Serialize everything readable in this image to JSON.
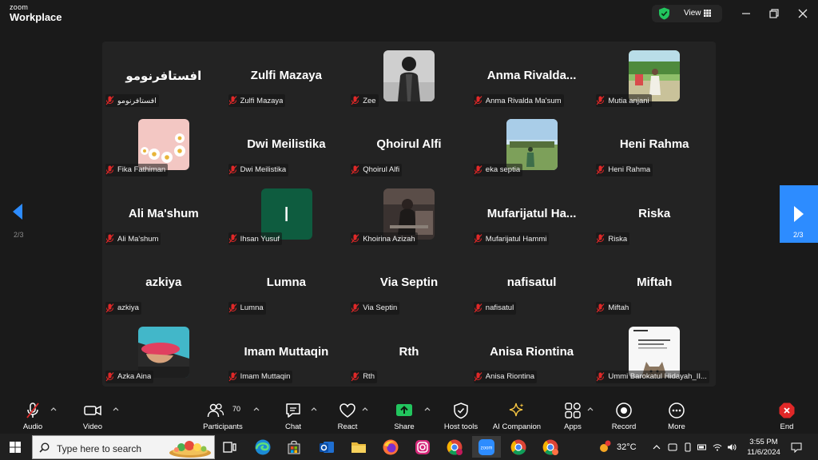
{
  "window": {
    "brand_line1": "zoom",
    "brand_line2": "Workplace",
    "view_label": "View",
    "security_color": "#22c55e",
    "controls": [
      "minimize-icon",
      "restore-icon",
      "close-icon"
    ]
  },
  "gallery": {
    "page_indicator": "2/3",
    "tiles": [
      {
        "big": "افستافرنومو",
        "plate": "افستافرنومو",
        "avatar": null
      },
      {
        "big": "Zulfi Mazaya",
        "plate": "Zulfi Mazaya",
        "avatar": null
      },
      {
        "big": "",
        "plate": "Zee",
        "avatar": "photo-person-dark"
      },
      {
        "big": "Anma  Rivalda...",
        "plate": "Anma Rivalda Ma'sum",
        "avatar": null
      },
      {
        "big": "",
        "plate": "Mutia anjani",
        "avatar": "photo-outdoor-green"
      },
      {
        "big": "",
        "plate": "Fika Fathiman",
        "avatar": "photo-daisies-pink"
      },
      {
        "big": "Dwi Meilistika",
        "plate": "Dwi Meilistika",
        "avatar": null
      },
      {
        "big": "Qhoirul Alfi",
        "plate": "Qhoirul Alfi",
        "avatar": null
      },
      {
        "big": "",
        "plate": "eka septia",
        "avatar": "photo-field-sky"
      },
      {
        "big": "Heni Rahma",
        "plate": "Heni Rahma",
        "avatar": null
      },
      {
        "big": "Ali Ma'shum",
        "plate": "Ali Ma'shum",
        "avatar": null
      },
      {
        "big": "",
        "plate": "Ihsan Yusuf",
        "avatar": "letter",
        "letter": "I"
      },
      {
        "big": "",
        "plate": "Khoirina Azizah",
        "avatar": "photo-person-piano"
      },
      {
        "big": "Mufarijatul  Ha...",
        "plate": "Mufarijatul Hammi",
        "avatar": null
      },
      {
        "big": "Riska",
        "plate": "Riska",
        "avatar": null
      },
      {
        "big": "azkiya",
        "plate": "azkiya",
        "avatar": null
      },
      {
        "big": "Lumna",
        "plate": "Lumna",
        "avatar": null
      },
      {
        "big": "Via Septin",
        "plate": "Via Septin",
        "avatar": null
      },
      {
        "big": "nafisatul",
        "plate": "nafisatul",
        "avatar": null
      },
      {
        "big": "Miftah",
        "plate": "Miftah",
        "avatar": null
      },
      {
        "big": "",
        "plate": "Azka Aina",
        "avatar": "photo-red-cap"
      },
      {
        "big": "Imam Muttaqin",
        "plate": "Imam Muttaqin",
        "avatar": null
      },
      {
        "big": "Rth",
        "plate": "Rth",
        "avatar": null
      },
      {
        "big": "Anisa Riontina",
        "plate": "Anisa Riontina",
        "avatar": null
      },
      {
        "big": "",
        "plate": "Ummi Barokatul Hidayah_II...",
        "avatar": "photo-document-cat"
      }
    ]
  },
  "toolbar": {
    "audio": "Audio",
    "video": "Video",
    "participants": "Participants",
    "participants_count": "70",
    "chat": "Chat",
    "react": "React",
    "share": "Share",
    "host_tools": "Host tools",
    "ai_companion": "AI Companion",
    "apps": "Apps",
    "record": "Record",
    "more": "More",
    "end": "End",
    "share_color": "#22c55e",
    "end_color": "#e02828"
  },
  "taskbar": {
    "search_placeholder": "Type here to search",
    "apps": [
      "task-view-icon",
      "edge-icon",
      "store-icon",
      "outlook-icon",
      "file-explorer-icon",
      "firefox-icon",
      "instagram-icon",
      "chrome-profile-icon",
      "zoom-icon",
      "chrome-icon",
      "chrome-alt-icon"
    ],
    "temperature": "32°C",
    "time": "3:55 PM",
    "date": "11/6/2024"
  }
}
